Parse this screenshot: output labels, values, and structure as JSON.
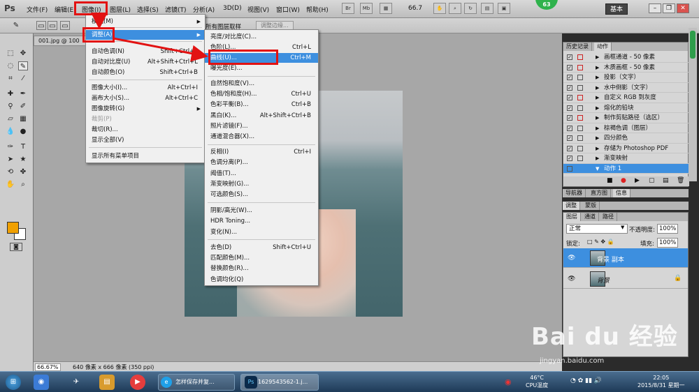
{
  "menubar": {
    "logo": "Ps",
    "items": [
      "文件(F)",
      "编辑(E)",
      "图像(I)",
      "图层(L)",
      "选择(S)",
      "滤镜(T)",
      "分析(A)",
      "3D(D)",
      "视图(V)",
      "窗口(W)",
      "帮助(H)"
    ],
    "br": "Br",
    "mb": "Mb",
    "zoom": "66.7",
    "badge": "63",
    "workspace": "基本"
  },
  "optbar": {
    "sample_all_layers": "所有图层取样",
    "refine_edge": "调整边缘..."
  },
  "document": {
    "tab": "001.jpg @ 100",
    "zoom": "66.67%",
    "size_info": "640 像素 x 666 像素 (350 ppi)"
  },
  "image_menu": {
    "items": [
      {
        "label": "模式(M)",
        "shortcut": "",
        "submenu": true
      },
      {
        "label": "调整(A)",
        "shortcut": "",
        "submenu": true,
        "highlight": true
      },
      {
        "label": "自动色调(N)",
        "shortcut": "Shift+Ctrl+L"
      },
      {
        "label": "自动对比度(U)",
        "shortcut": "Alt+Shift+Ctrl+L"
      },
      {
        "label": "自动颜色(O)",
        "shortcut": "Shift+Ctrl+B"
      },
      {
        "label": "图像大小(I)...",
        "shortcut": "Alt+Ctrl+I"
      },
      {
        "label": "画布大小(S)...",
        "shortcut": "Alt+Ctrl+C"
      },
      {
        "label": "图像旋转(G)",
        "shortcut": "",
        "submenu": true
      },
      {
        "label": "裁剪(P)",
        "shortcut": "",
        "disabled": true
      },
      {
        "label": "裁切(R)...",
        "shortcut": ""
      },
      {
        "label": "显示全部(V)",
        "shortcut": ""
      },
      {
        "label": "显示所有菜单项目",
        "shortcut": ""
      }
    ]
  },
  "adjust_menu": {
    "items": [
      {
        "label": "亮度/对比度(C)...",
        "shortcut": ""
      },
      {
        "label": "色阶(L)...",
        "shortcut": "Ctrl+L"
      },
      {
        "label": "曲线(U)...",
        "shortcut": "Ctrl+M",
        "highlight": true
      },
      {
        "label": "曝光度(E)...",
        "shortcut": ""
      },
      {
        "label": "自然饱和度(V)...",
        "shortcut": ""
      },
      {
        "label": "色相/饱和度(H)...",
        "shortcut": "Ctrl+U"
      },
      {
        "label": "色彩平衡(B)...",
        "shortcut": "Ctrl+B"
      },
      {
        "label": "黑白(K)...",
        "shortcut": "Alt+Shift+Ctrl+B"
      },
      {
        "label": "照片滤镜(F)...",
        "shortcut": ""
      },
      {
        "label": "通道混合器(X)...",
        "shortcut": ""
      },
      {
        "label": "反相(I)",
        "shortcut": "Ctrl+I"
      },
      {
        "label": "色调分离(P)...",
        "shortcut": ""
      },
      {
        "label": "阈值(T)...",
        "shortcut": ""
      },
      {
        "label": "渐变映射(G)...",
        "shortcut": ""
      },
      {
        "label": "可选颜色(S)...",
        "shortcut": ""
      },
      {
        "label": "阴影/高光(W)...",
        "shortcut": ""
      },
      {
        "label": "HDR Toning...",
        "shortcut": ""
      },
      {
        "label": "变化(N)...",
        "shortcut": ""
      },
      {
        "label": "去色(D)",
        "shortcut": "Shift+Ctrl+U"
      },
      {
        "label": "匹配颜色(M)...",
        "shortcut": ""
      },
      {
        "label": "替换颜色(R)...",
        "shortcut": ""
      },
      {
        "label": "色调均化(Q)",
        "shortcut": ""
      }
    ]
  },
  "history_panel": {
    "tabs": [
      "历史记录",
      "动作"
    ],
    "rows": [
      "画框通道 - 50 像素",
      "木质画框 - 50 像素",
      "投影（文字）",
      "水中倒影（文字）",
      "自定义 RGB 到灰度",
      "熔化的铅块",
      "制作剪贴路径（选区）",
      "棕褐色调（图层）",
      "四分颜色",
      "存储为 Photoshop PDF",
      "渐变映射",
      "动作 1"
    ]
  },
  "nav_tabs": [
    "导航器",
    "直方图",
    "信息"
  ],
  "adj_tabs": [
    "调整",
    "蒙版"
  ],
  "layers_panel": {
    "tabs": [
      "图层",
      "通道",
      "路径"
    ],
    "blend": "正常",
    "opacity_label": "不透明度:",
    "opacity": "100%",
    "lock_label": "锁定:",
    "fill_label": "填充:",
    "fill": "100%",
    "layers": [
      "背景 副本",
      "背景"
    ]
  },
  "taskbar": {
    "buttons": [
      "怎样保存并复...",
      "1629543562-1.j..."
    ],
    "temp": "46°C",
    "temp_label": "CPU温度",
    "time": "22:05",
    "date": "2015/8/31 星期一"
  },
  "watermark": {
    "brand": "Bai du 经验",
    "url": "jingyan.baidu.com"
  }
}
